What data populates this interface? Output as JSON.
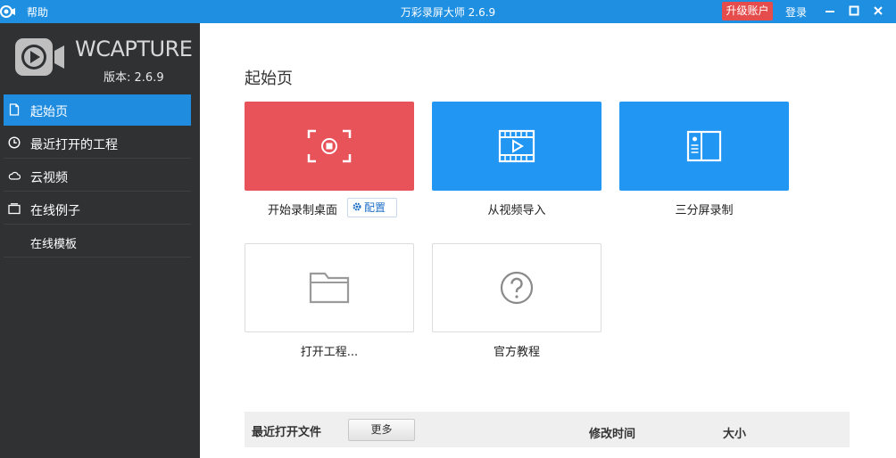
{
  "titlebar": {
    "help": "帮助",
    "title": "万彩录屏大师 2.6.9",
    "upgrade": "升级账户",
    "login": "登录",
    "bg_color": "#1e8fe1"
  },
  "sidebar": {
    "logo_text": "WCAPTURE",
    "version": "版本: 2.6.9",
    "items": [
      {
        "label": "起始页",
        "icon": "page-icon",
        "active": true
      },
      {
        "label": "最近打开的工程",
        "icon": "clock-icon"
      },
      {
        "label": "云视频",
        "icon": "cloud-icon"
      },
      {
        "label": "在线例子",
        "icon": "folder-tab-icon"
      },
      {
        "label": "在线模板",
        "icon": ""
      }
    ]
  },
  "main": {
    "page_title": "起始页",
    "tiles": [
      {
        "label": "开始录制桌面",
        "icon": "record-screen-icon",
        "color": "#e8535a"
      },
      {
        "label": "从视频导入",
        "icon": "film-play-icon",
        "color": "#2196f3"
      },
      {
        "label": "三分屏录制",
        "icon": "split-screen-icon",
        "color": "#2196f3"
      },
      {
        "label": "打开工程...",
        "icon": "folder-icon"
      },
      {
        "label": "官方教程",
        "icon": "help-circle-icon"
      }
    ],
    "config_label": "配置",
    "recent": {
      "title": "最近打开文件",
      "more": "更多",
      "col_modified": "修改时间",
      "col_size": "大小"
    }
  }
}
